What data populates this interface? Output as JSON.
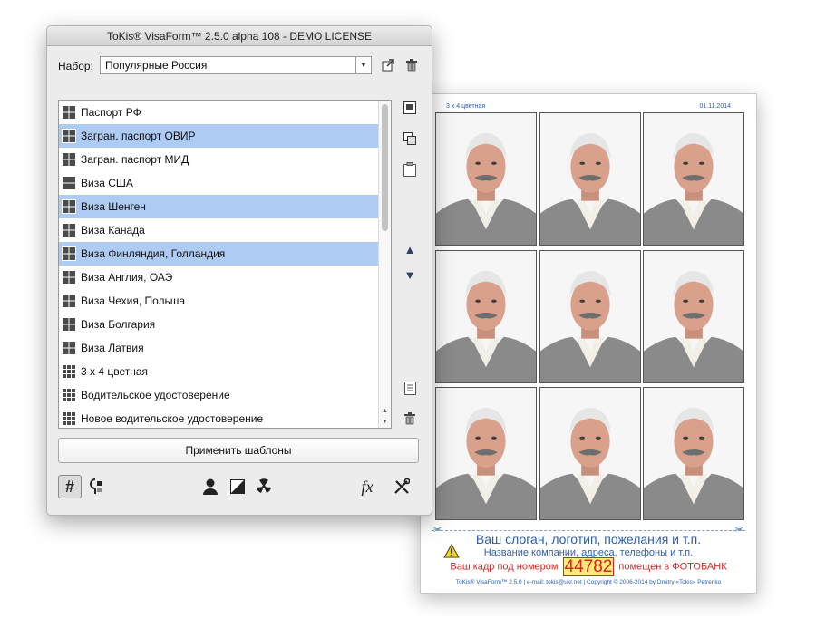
{
  "window": {
    "title": "ToKis® VisaForm™ 2.5.0 alpha 108 - DEMO LICENSE"
  },
  "set": {
    "label": "Набор:",
    "value": "Популярные Россия"
  },
  "templates": [
    {
      "label": "Паспорт РФ",
      "selected": false,
      "icon": "grid-2x2-icon"
    },
    {
      "label": "Загран. паспорт ОВИР",
      "selected": true,
      "icon": "grid-2x2-icon"
    },
    {
      "label": "Загран. паспорт МИД",
      "selected": false,
      "icon": "grid-2x2-icon"
    },
    {
      "label": "Виза США",
      "selected": false,
      "icon": "grid-1x2-icon"
    },
    {
      "label": "Виза Шенген",
      "selected": true,
      "icon": "grid-2x2-icon"
    },
    {
      "label": "Виза Канада",
      "selected": false,
      "icon": "grid-2x2-icon"
    },
    {
      "label": "Виза Финляндия, Голландия",
      "selected": true,
      "icon": "grid-2x2-icon"
    },
    {
      "label": "Виза Англия, ОАЭ",
      "selected": false,
      "icon": "grid-2x2-icon"
    },
    {
      "label": "Виза Чехия, Польша",
      "selected": false,
      "icon": "grid-2x2-icon"
    },
    {
      "label": "Виза Болгария",
      "selected": false,
      "icon": "grid-2x2-icon"
    },
    {
      "label": "Виза Латвия",
      "selected": false,
      "icon": "grid-2x2-icon"
    },
    {
      "label": "3 х 4 цветная",
      "selected": false,
      "icon": "grid-3x3-icon"
    },
    {
      "label": "Водительское удостоверение",
      "selected": false,
      "icon": "grid-3x3-icon"
    },
    {
      "label": "Новое водительское удостоверение",
      "selected": false,
      "icon": "grid-3x3-icon"
    }
  ],
  "apply_button": "Применить шаблоны",
  "toolbar": {
    "icons": [
      "grid-hash-icon",
      "flip-portrait-icon",
      "person-icon",
      "contrast-icon",
      "radiation-icon",
      "fx-icon",
      "tools-icon"
    ]
  },
  "side_icons": [
    "single-layout-icon",
    "copy-template-icon",
    "paste-template-icon",
    "move-up-icon",
    "move-down-icon",
    "clear-list-icon",
    "trash-icon"
  ],
  "preview": {
    "header_left": "3 х 4 цветная",
    "header_right": "01.11.2014",
    "slogan": "Ваш слоган, логотип, пожелания и т.п.",
    "company": "Название компании, адреса, телефоны и т.п.",
    "frame_before": "Ваш кадр под номером",
    "frame_number": "44782",
    "frame_after": "помещен в ФОТОБАНК",
    "footer": "ToKis® VisaForm™ 2.5.0 | e-mail: tokis@ukr.net | Copyright © 2006-2014 by Dmitry «Tokis» Petrenko",
    "photo_count": 9
  },
  "colors": {
    "selection": "#aecbf3",
    "accent_blue": "#2f5fa8",
    "accent_red": "#d62a2a"
  }
}
